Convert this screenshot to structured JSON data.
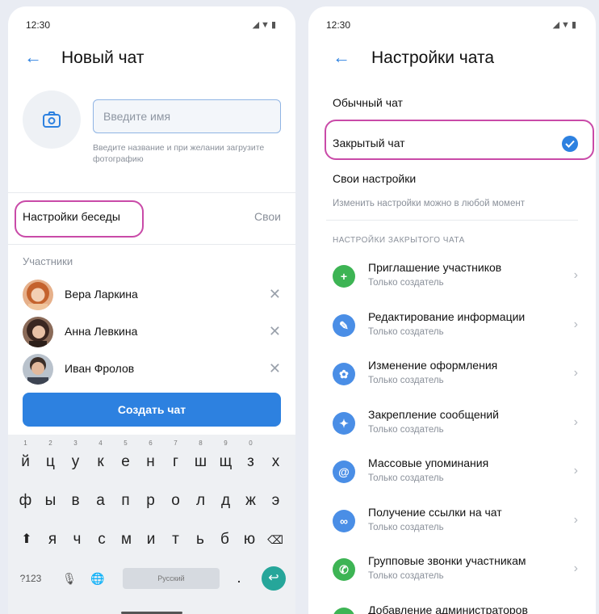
{
  "left": {
    "status": {
      "time": "12:30",
      "icons": "◢▼▮"
    },
    "title": "Новый чат",
    "name_input": {
      "placeholder": "Введите имя"
    },
    "name_hint": "Введите название и при желании загрузите фотографию",
    "chat_settings": {
      "label": "Настройки беседы",
      "value": "Свои"
    },
    "participants_title": "Участники",
    "participants": [
      {
        "name": "Вера Ларкина"
      },
      {
        "name": "Анна Левкина"
      },
      {
        "name": "Иван Фролов"
      }
    ],
    "create_button": "Создать чат",
    "keyboard": {
      "row1": [
        {
          "k": "й",
          "n": "1"
        },
        {
          "k": "ц",
          "n": "2"
        },
        {
          "k": "у",
          "n": "3"
        },
        {
          "k": "к",
          "n": "4"
        },
        {
          "k": "е",
          "n": "5"
        },
        {
          "k": "н",
          "n": "6"
        },
        {
          "k": "г",
          "n": "7"
        },
        {
          "k": "ш",
          "n": "8"
        },
        {
          "k": "щ",
          "n": "9"
        },
        {
          "k": "з",
          "n": "0"
        },
        {
          "k": "х",
          "n": ""
        }
      ],
      "row2": [
        "ф",
        "ы",
        "в",
        "а",
        "п",
        "р",
        "о",
        "л",
        "д",
        "ж",
        "э"
      ],
      "row3": [
        "я",
        "ч",
        "с",
        "м",
        "и",
        "т",
        "ь",
        "б",
        "ю"
      ],
      "num_key": "?123",
      "space_label": "Русский",
      "period_key": "."
    }
  },
  "right": {
    "status": {
      "time": "12:30",
      "icons": "◢▼▮"
    },
    "title": "Настройки чата",
    "options": [
      {
        "label": "Обычный чат"
      },
      {
        "label": "Закрытый чат"
      },
      {
        "label": "Свои настройки"
      }
    ],
    "options_hint": "Изменить настройки можно в любой момент",
    "section_caption": "НАСТРОЙКИ ЗАКРЫТОГО ЧАТА",
    "settings": [
      {
        "title": "Приглашение участников",
        "sub": "Только создатель",
        "glyph": "+",
        "color": "#3db454"
      },
      {
        "title": "Редактирование информации",
        "sub": "Только создатель",
        "glyph": "✎",
        "color": "#4a8ee6"
      },
      {
        "title": "Изменение оформления",
        "sub": "Только создатель",
        "glyph": "✿",
        "color": "#4a8ee6"
      },
      {
        "title": "Закрепление сообщений",
        "sub": "Только создатель",
        "glyph": "✦",
        "color": "#4a8ee6"
      },
      {
        "title": "Массовые упоминания",
        "sub": "Только создатель",
        "glyph": "@",
        "color": "#4a8ee6"
      },
      {
        "title": "Получение ссылки на чат",
        "sub": "Только создатель",
        "glyph": "∞",
        "color": "#4a8ee6"
      },
      {
        "title": "Групповые звонки участникам",
        "sub": "Только создатель",
        "glyph": "✆",
        "color": "#3db454"
      },
      {
        "title": "Добавление администраторов",
        "sub": "",
        "glyph": "•",
        "color": "#3db454"
      }
    ]
  },
  "colors": {
    "accent": "#2d81e0",
    "highlight": "#c94aa8"
  }
}
